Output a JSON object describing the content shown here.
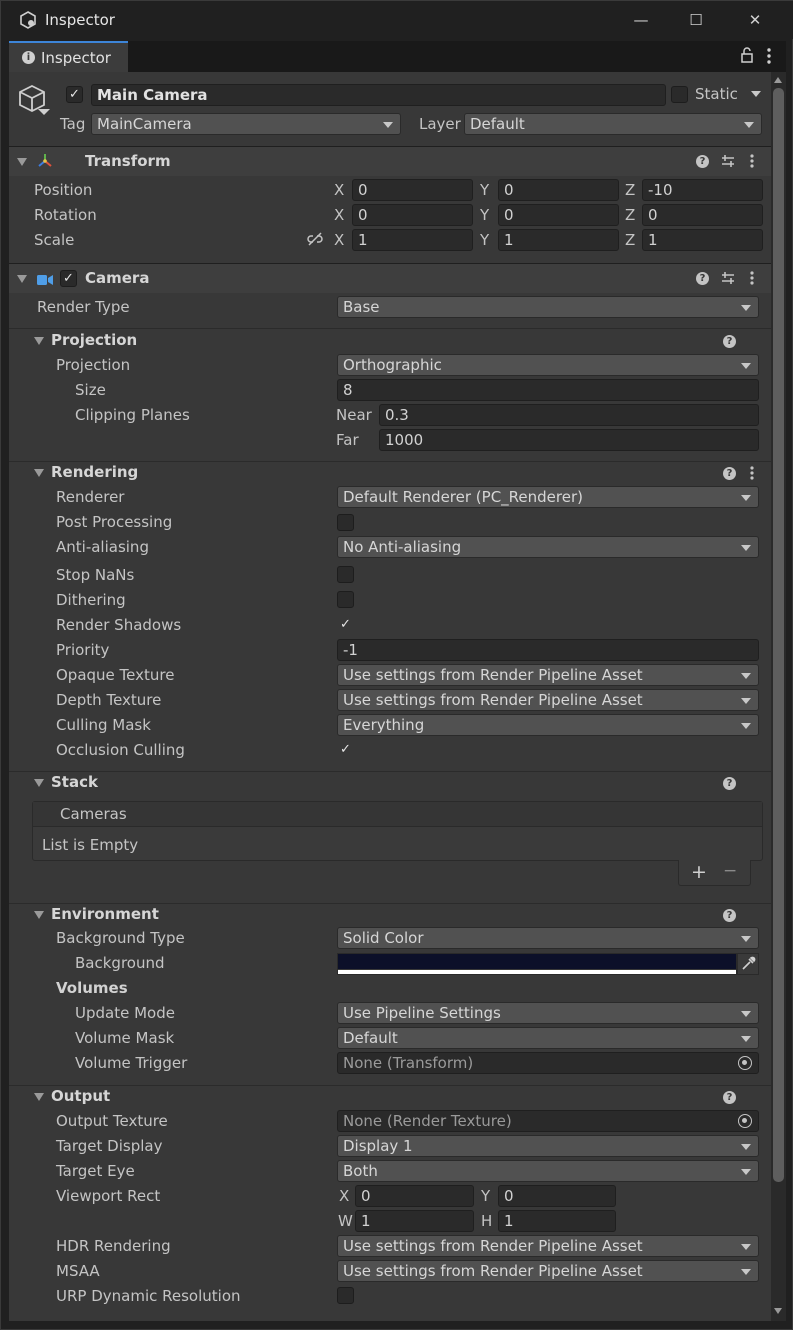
{
  "window": {
    "title": "Inspector",
    "minimize": "—",
    "maximize": "☐",
    "close": "✕"
  },
  "tab": {
    "label": "Inspector",
    "lock": "🔓",
    "menu": "⋮"
  },
  "object": {
    "active": true,
    "name": "Main Camera",
    "static_label": "Static",
    "tag_label": "Tag",
    "tag_value": "MainCamera",
    "layer_label": "Layer",
    "layer_value": "Default"
  },
  "transform": {
    "title": "Transform",
    "position_label": "Position",
    "rotation_label": "Rotation",
    "scale_label": "Scale",
    "position": {
      "x": "0",
      "y": "0",
      "z": "-10"
    },
    "rotation": {
      "x": "0",
      "y": "0",
      "z": "0"
    },
    "scale": {
      "x": "1",
      "y": "1",
      "z": "1"
    },
    "axis_x": "X",
    "axis_y": "Y",
    "axis_z": "Z"
  },
  "camera": {
    "title": "Camera",
    "render_type_label": "Render Type",
    "render_type": "Base"
  },
  "projection": {
    "title": "Projection",
    "projection_label": "Projection",
    "projection_value": "Orthographic",
    "size_label": "Size",
    "size_value": "8",
    "clipping_label": "Clipping Planes",
    "near_label": "Near",
    "near_value": "0.3",
    "far_label": "Far",
    "far_value": "1000"
  },
  "rendering": {
    "title": "Rendering",
    "renderer_label": "Renderer",
    "renderer_value": "Default Renderer (PC_Renderer)",
    "post_label": "Post Processing",
    "post_checked": false,
    "aa_label": "Anti-aliasing",
    "aa_value": "No Anti-aliasing",
    "nans_label": "Stop NaNs",
    "nans_checked": false,
    "dither_label": "Dithering",
    "dither_checked": false,
    "shadows_label": "Render Shadows",
    "shadows_checked": true,
    "priority_label": "Priority",
    "priority_value": "-1",
    "opaque_label": "Opaque Texture",
    "opaque_value": "Use settings from Render Pipeline Asset",
    "depth_label": "Depth Texture",
    "depth_value": "Use settings from Render Pipeline Asset",
    "culling_label": "Culling Mask",
    "culling_value": "Everything",
    "occlusion_label": "Occlusion Culling",
    "occlusion_checked": true
  },
  "stack": {
    "title": "Stack",
    "cameras_label": "Cameras",
    "empty_text": "List is Empty",
    "add": "+",
    "remove": "−"
  },
  "environment": {
    "title": "Environment",
    "bg_type_label": "Background Type",
    "bg_type_value": "Solid Color",
    "bg_label": "Background",
    "bg_color": "#0c1029",
    "volumes_label": "Volumes",
    "update_label": "Update Mode",
    "update_value": "Use Pipeline Settings",
    "mask_label": "Volume Mask",
    "mask_value": "Default",
    "trigger_label": "Volume Trigger",
    "trigger_value": "None (Transform)"
  },
  "output": {
    "title": "Output",
    "texture_label": "Output Texture",
    "texture_value": "None (Render Texture)",
    "display_label": "Target Display",
    "display_value": "Display 1",
    "eye_label": "Target Eye",
    "eye_value": "Both",
    "viewport_label": "Viewport Rect",
    "vx": "0",
    "vy": "0",
    "vw": "1",
    "vh": "1",
    "x_l": "X",
    "y_l": "Y",
    "w_l": "W",
    "h_l": "H",
    "hdr_label": "HDR Rendering",
    "hdr_value": "Use settings from Render Pipeline Asset",
    "msaa_label": "MSAA",
    "msaa_value": "Use settings from Render Pipeline Asset",
    "urp_label": "URP Dynamic Resolution",
    "urp_checked": false
  },
  "colors": {
    "accent": "#3d85d8",
    "panel": "#383838",
    "field": "#2a2a2a"
  }
}
